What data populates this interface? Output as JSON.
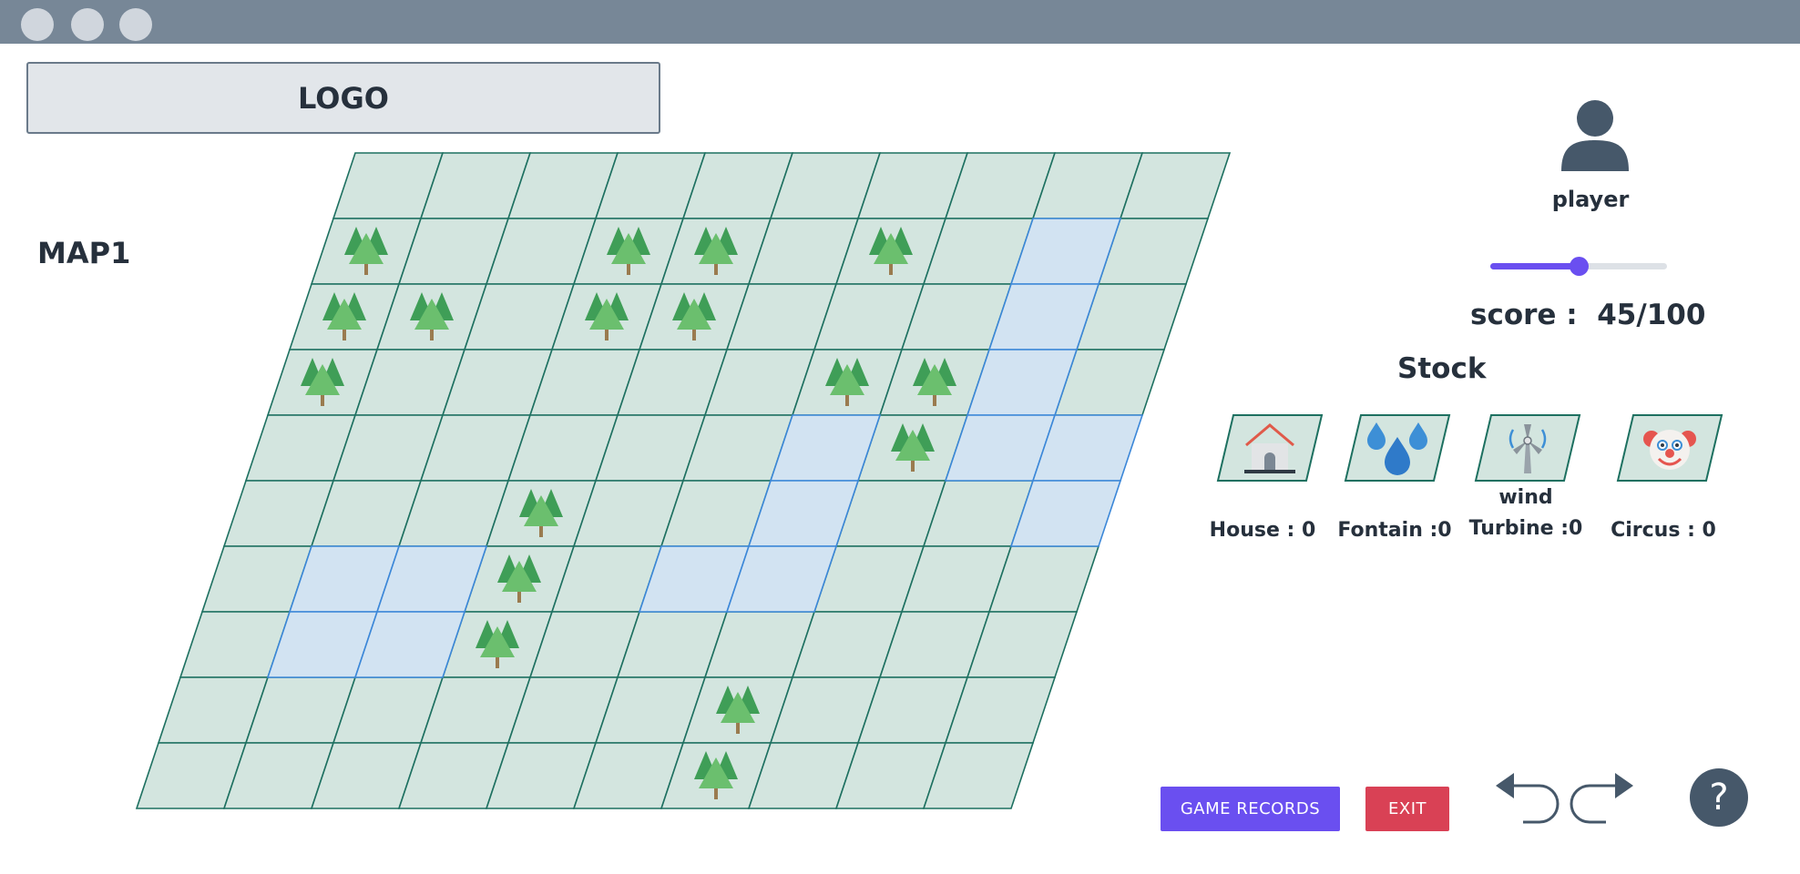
{
  "window": {
    "controls": [
      "close",
      "minimize",
      "maximize"
    ]
  },
  "logo": {
    "text": "LOGO"
  },
  "map": {
    "title": "MAP1",
    "rows": 10,
    "cols": 10,
    "colors": {
      "grass": "#d3e5df",
      "grass_border": "#1d7060",
      "water": "#d2e3f2",
      "water_border": "#3b87d8"
    },
    "water_cells": [
      [
        1,
        8
      ],
      [
        2,
        8
      ],
      [
        3,
        8
      ],
      [
        4,
        6
      ],
      [
        4,
        8
      ],
      [
        4,
        9
      ],
      [
        5,
        6
      ],
      [
        5,
        9
      ],
      [
        6,
        1
      ],
      [
        6,
        2
      ],
      [
        6,
        5
      ],
      [
        6,
        6
      ],
      [
        7,
        1
      ],
      [
        7,
        2
      ]
    ],
    "tree_cells": [
      [
        1,
        0
      ],
      [
        1,
        3
      ],
      [
        1,
        4
      ],
      [
        1,
        6
      ],
      [
        2,
        0
      ],
      [
        2,
        1
      ],
      [
        2,
        3
      ],
      [
        2,
        4
      ],
      [
        3,
        0
      ],
      [
        3,
        6
      ],
      [
        3,
        7
      ],
      [
        4,
        7
      ],
      [
        5,
        3
      ],
      [
        6,
        3
      ],
      [
        7,
        3
      ],
      [
        8,
        6
      ],
      [
        9,
        6
      ]
    ]
  },
  "player": {
    "name": "player",
    "progress": 0.5
  },
  "score": {
    "label": "score :",
    "value": "45/100"
  },
  "stock": {
    "title": "Stock",
    "items": [
      {
        "icon": "house-icon",
        "label": "House : 0"
      },
      {
        "icon": "fountain-icon",
        "label": "Fontain :0"
      },
      {
        "icon": "wind-turbine-icon",
        "label": "wind\nTurbine :0"
      },
      {
        "icon": "circus-clown-icon",
        "label": "Circus : 0"
      }
    ]
  },
  "buttons": {
    "game_records": "GAME RECORDS",
    "exit": "EXIT"
  },
  "controls": {
    "undo_icon": "undo-arrow-icon",
    "redo_icon": "redo-arrow-icon",
    "help_label": "?"
  },
  "colors": {
    "accent": "#6a4ff0",
    "danger": "#d94155",
    "titlebar": "#778797"
  }
}
